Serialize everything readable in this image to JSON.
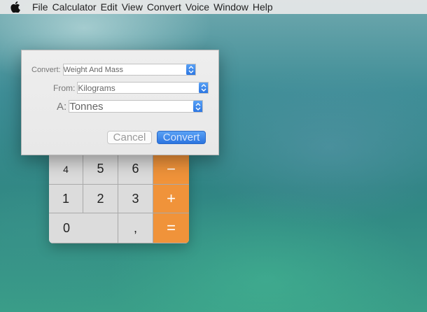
{
  "menubar": {
    "apple_icon": "apple-icon",
    "items": [
      "File",
      "Calculator",
      "Edit",
      "View",
      "Convert",
      "Voice",
      "Window",
      "Help"
    ]
  },
  "dialog": {
    "convert_label": "Convert:",
    "convert_value": "Weight And Mass",
    "from_label": "From:",
    "from_value": "Kilograms",
    "to_label": "A:",
    "to_value": "Tonnes",
    "cancel_label": "Cancel",
    "convert_button_label": "Convert"
  },
  "calculator": {
    "keys": {
      "k4": "4",
      "k5": "5",
      "k6": "6",
      "minus": "−",
      "k1": "1",
      "k2": "2",
      "k3": "3",
      "plus": "+",
      "k0": "0",
      "decimal": ",",
      "equals": "="
    }
  },
  "colors": {
    "accent_orange": "#f0933a",
    "accent_blue": "#2b74e0"
  }
}
